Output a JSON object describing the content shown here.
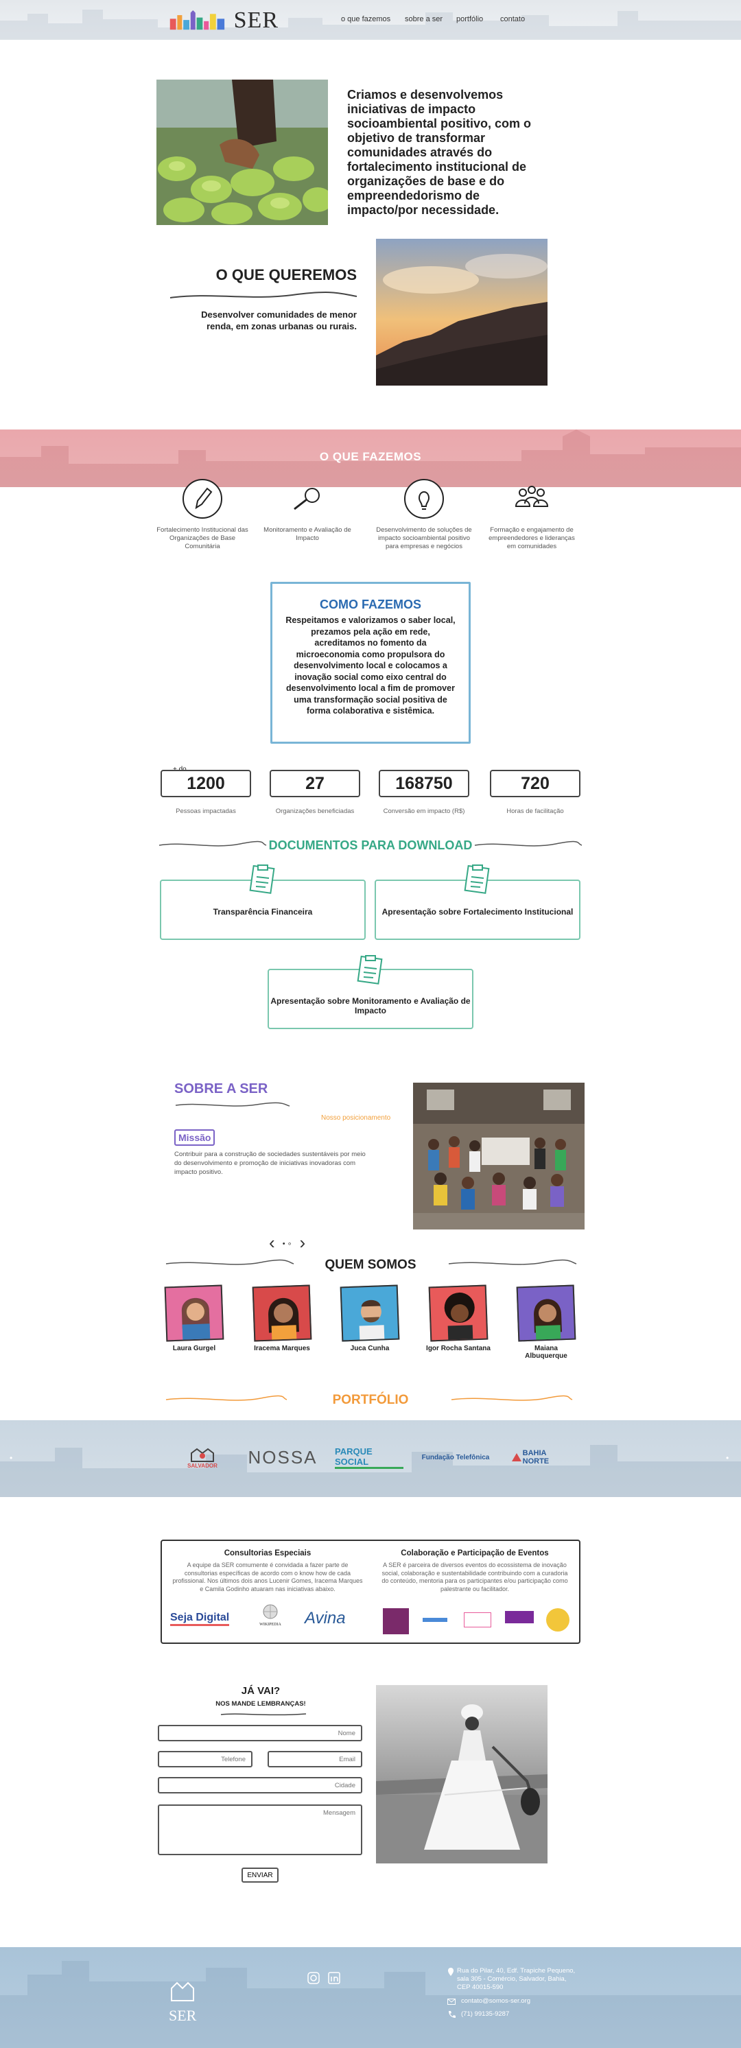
{
  "header": {
    "logo_text": "SER",
    "nav": [
      "o que fazemos",
      "sobre a ser",
      "portfólio",
      "contato"
    ]
  },
  "hero": {
    "text": "Criamos e desenvolvemos iniciativas de impacto socioambiental positivo, com o objetivo de transformar comunidades através do fortalecimento institucional de organizações de base e do empreendedorismo de impacto/por necessidade."
  },
  "queremos": {
    "title": "O QUE QUEREMOS",
    "text": "Desenvolver comunidades de menor renda, em zonas urbanas ou rurais."
  },
  "fazemos": {
    "title": "O QUE FAZEMOS",
    "items": [
      {
        "icon": "pencil-icon",
        "label": "Fortalecimento Institucional das Organizações de Base Comunitária"
      },
      {
        "icon": "magnifier-icon",
        "label": "Monitoramento e Avaliação de Impacto"
      },
      {
        "icon": "lightbulb-icon",
        "label": "Desenvolvimento de soluções de impacto socioambiental positivo para empresas e negócios"
      },
      {
        "icon": "people-icon",
        "label": "Formação e engajamento de empreendedores e lideranças em comunidades"
      }
    ]
  },
  "como": {
    "title": "COMO FAZEMOS",
    "text": "Respeitamos e valorizamos o saber local, prezamos pela ação em rede, acreditamos no fomento da microeconomia como propulsora do desenvolvimento local e colocamos a inovação social como eixo central do desenvolvimento local a fim de promover uma transformação social positiva de forma colaborativa e sistêmica."
  },
  "stats": {
    "prefix": "+ do",
    "items": [
      {
        "value": "1200",
        "label": "Pessoas impactadas"
      },
      {
        "value": "27",
        "label": "Organizações beneficiadas"
      },
      {
        "value": "168750",
        "label": "Conversão em impacto (R$)"
      },
      {
        "value": "720",
        "label": "Horas de facilitação"
      }
    ]
  },
  "docs": {
    "title": "DOCUMENTOS PARA DOWNLOAD",
    "items": [
      "Transparência Financeira",
      "Apresentação sobre Fortalecimento Institucional",
      "Apresentação sobre Monitoramento e Avaliação de Impacto"
    ]
  },
  "sobre": {
    "title": "SOBRE A SER",
    "link": "Nosso posicionamento",
    "missao_label": "Missão",
    "missao_text": "Contribuir para a construção de sociedades sustentáveis por meio do desenvolvimento e promoção de iniciativas inovadoras com impacto positivo.",
    "slider_prev": "‹",
    "slider_dots": "• ∘",
    "slider_next": "›"
  },
  "quem": {
    "title": "QUEM SOMOS",
    "people": [
      "Laura Gurgel",
      "Iracema Marques",
      "Juca Cunha",
      "Igor Rocha Santana",
      "Maiana Albuquerque"
    ]
  },
  "portfolio": {
    "title": "PORTFÓLIO",
    "partners": [
      "SALVADOR",
      "NOSSA",
      "PARQUE SOCIAL",
      "Fundação Telefônica",
      "BAHIA NORTE"
    ]
  },
  "consult": {
    "left_title": "Consultorias Especiais",
    "left_text": "A equipe da SER comumente é convidada a fazer parte de consultorias específicas de acordo com o know how de cada profissional. Nos últimos dois anos Lucenir Gomes, Iracema Marques e Camila Godinho atuaram nas iniciativas abaixo.",
    "right_title": "Colaboração e Participação de Eventos",
    "right_text": "A SER é parceira de diversos eventos do ecossistema de inovação social, colaboração e sustentabilidade contribuindo com a curadoria do conteúdo, mentoria para os participantes e/ou participação como palestrante ou facilitador.",
    "logos_left": [
      "Seja Digital",
      "WIKIPEDIA",
      "Avina"
    ]
  },
  "form": {
    "title": "JÁ VAI?",
    "subtitle": "NOS MANDE LEMBRANÇAS!",
    "nome": "Nome",
    "telefone": "Telefone",
    "email": "Email",
    "cidade": "Cidade",
    "mensagem": "Mensagem",
    "button": "ENVIAR"
  },
  "footer": {
    "logo_text": "SER",
    "address": "Rua do Pilar, 40, Edf. Trapiche Pequeno, sala 305 - Comércio, Salvador, Bahia, CEP 40015-590",
    "email": "contato@somos-ser.org",
    "phone": "(71) 99135-9287"
  }
}
